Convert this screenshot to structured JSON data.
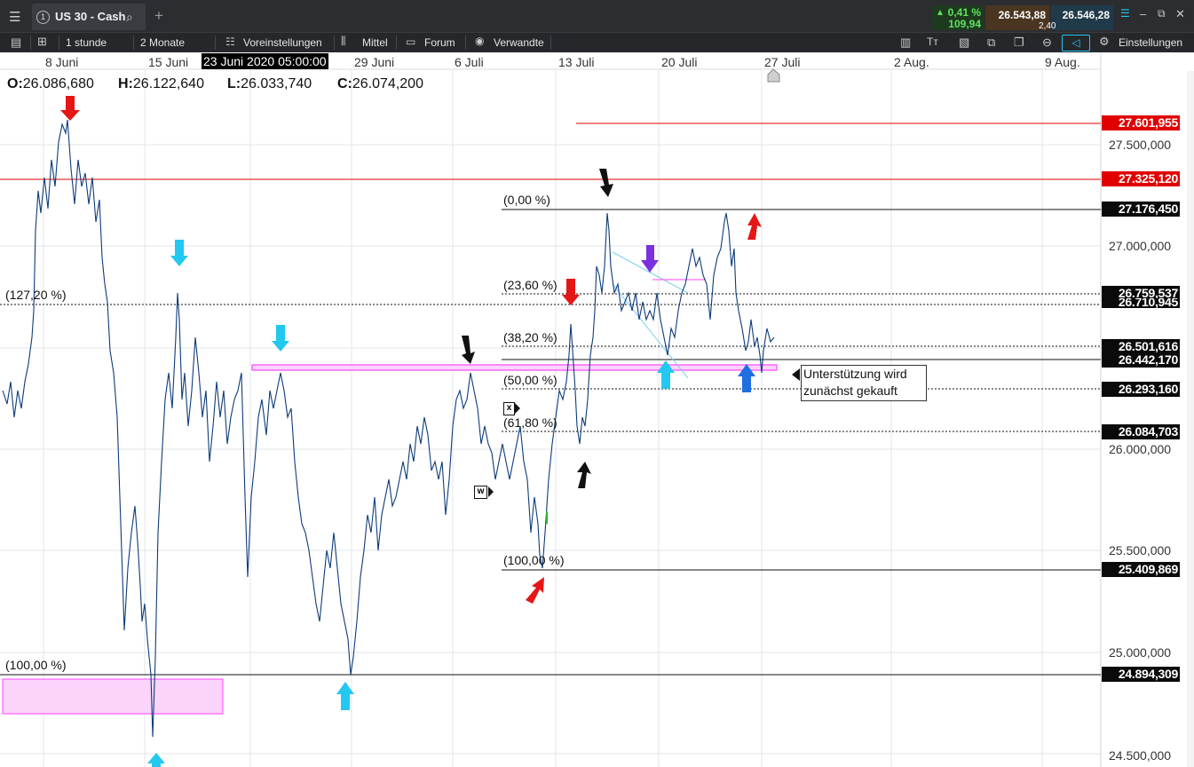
{
  "window": {
    "tab_number": "1",
    "tab_title": "US 30 - Cash",
    "change_pct": "0,41 %",
    "change_abs": "109,94",
    "bid": "26.543,88",
    "ask": "26.546,28",
    "spread": "2,40"
  },
  "toolbar": {
    "interval": "1 stunde",
    "range": "2 Monate",
    "presets": "Voreinstellungen",
    "indicator": "Mittel",
    "forum": "Forum",
    "related": "Verwandte",
    "settings": "Einstellungen"
  },
  "xaxis": {
    "labels": [
      "8 Juni",
      "15 Juni",
      "29 Juni",
      "6 Juli",
      "13 Juli",
      "20 Juli",
      "27 Juli",
      "2 Aug.",
      "9 Aug."
    ],
    "crosshair_time": "23 Juni 2020 05:00:00"
  },
  "ohlc": {
    "o_label": "O:",
    "o": "26.086,680",
    "h_label": "H:",
    "h": "26.122,640",
    "l_label": "L:",
    "l": "26.033,740",
    "c_label": "C:",
    "c": "26.074,200"
  },
  "yaxis": {
    "ticks": [
      "27.500,000",
      "27.000,000",
      "26.000,000",
      "25.500,000",
      "25.000,000",
      "24.500,000"
    ]
  },
  "price_labels": {
    "p1": "27.601,955",
    "p2": "27.325,120",
    "p3": "27.176,450",
    "p4": "26.759,537",
    "p5": "26.710,945",
    "p6": "26.501,616",
    "p7": "26.442,170",
    "p8": "26.293,160",
    "p9": "26.084,703",
    "p10": "25.409,869",
    "p11": "24.894,309"
  },
  "fib_labels": {
    "f0": "(0,00 %)",
    "f236": "(23,60 %)",
    "f382": "(38,20 %)",
    "f50": "(50,00 %)",
    "f618": "(61,80 %)",
    "f100": "(100,00 %)",
    "ext127": "(127,20 %)",
    "ext100": "(100,00 %)"
  },
  "annotation": {
    "line1": "Unterstützung wird",
    "line2": "zunächst gekauft"
  },
  "markers": {
    "x_label": "x",
    "w_label": "w"
  },
  "colors": {
    "candle": "#0d3b7a",
    "resistance": "#e00000",
    "support_zone": "#ff66ff",
    "arrow_red": "#e51616",
    "arrow_black": "#111111",
    "arrow_cyan": "#22c8f0",
    "arrow_blue": "#1f6fe0",
    "arrow_purple": "#7b2fe0"
  }
}
